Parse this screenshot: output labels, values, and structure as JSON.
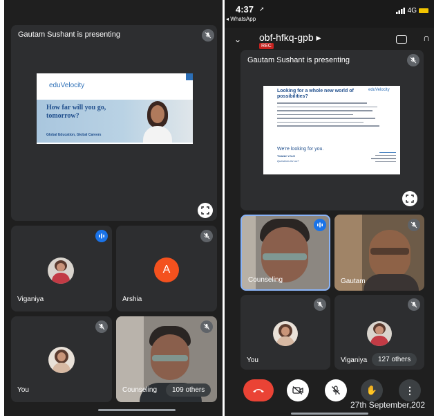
{
  "left_screen": {
    "presenting_label": "Gautam Sushant is presenting",
    "slide": {
      "brand": "eduVelocity",
      "headline": "How far will you go, tomorrow?",
      "tagline": "Global Education, Global Careers"
    },
    "participants": [
      {
        "name": "Viganiya"
      },
      {
        "name": "Arshia",
        "initial": "A"
      },
      {
        "name": "You"
      },
      {
        "name": "Counseling"
      }
    ],
    "others_count": "109 others"
  },
  "right_screen": {
    "status_time": "4:37",
    "back_app": "◂ WhatsApp",
    "network": "4G",
    "meeting_code": "obf-hfkq-gpb ▸",
    "rec_label": "REC",
    "presenting_label": "Gautam Sushant is presenting",
    "slide": {
      "brand": "eduVelocity",
      "question": "Looking for a whole new world of possibilities?",
      "tagline": "We're looking for you.",
      "thanks": "THANK YOU!!",
      "questions": "Questions for us?"
    },
    "participants": [
      {
        "name": "Counseling"
      },
      {
        "name": "Gautam"
      },
      {
        "name": "You"
      },
      {
        "name": "Viganiya"
      }
    ],
    "others_count": "127 others",
    "date_stamp": "27th September,202"
  },
  "colors": {
    "background": "#1f1f1f",
    "tile": "#2d2e30",
    "accent_blue": "#1a73e8",
    "end_call_red": "#ea4335",
    "avatar_orange": "#f4511e"
  }
}
